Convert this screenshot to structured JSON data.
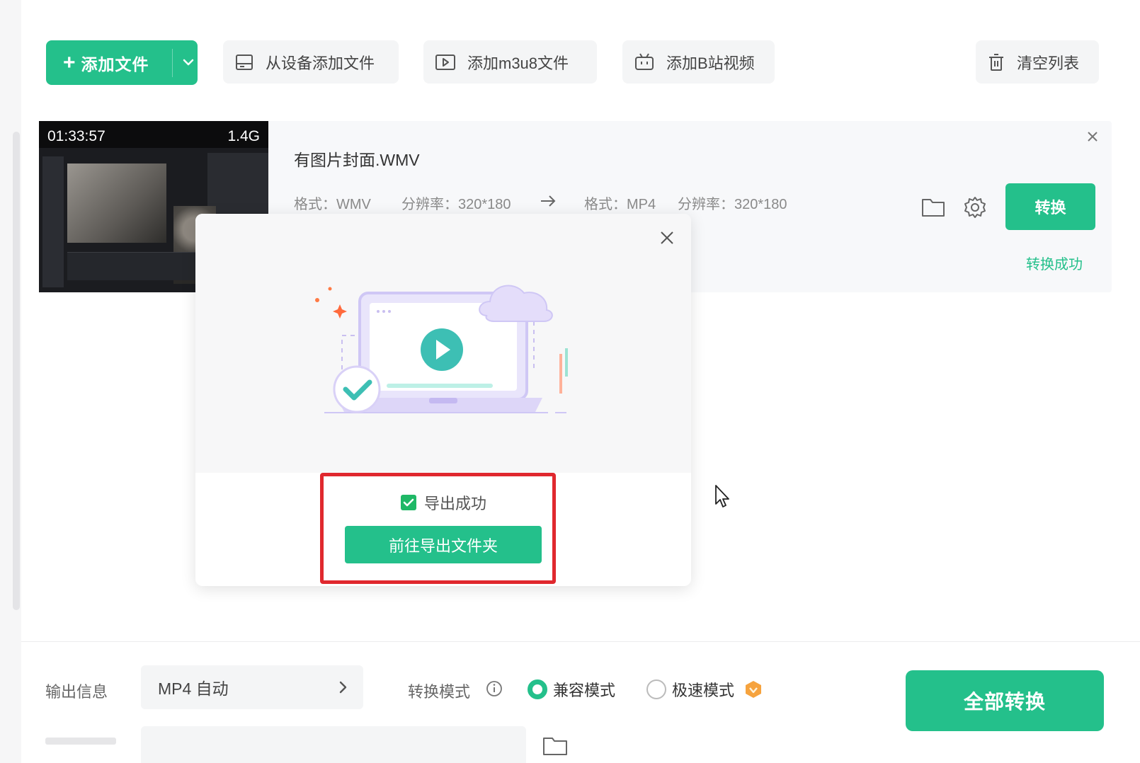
{
  "toolbar": {
    "add_file_label": "添加文件",
    "add_from_device_label": "从设备添加文件",
    "add_m3u8_label": "添加m3u8文件",
    "add_bilibili_label": "添加B站视频",
    "clear_list_label": "清空列表"
  },
  "file": {
    "duration": "01:33:57",
    "size": "1.4G",
    "name": "有图片封面.WMV",
    "input_format": "格式：WMV",
    "input_resolution": "分辨率：320*180",
    "output_format": "格式：MP4",
    "output_resolution": "分辨率：320*180",
    "convert_label": "转换",
    "status": "转换成功"
  },
  "modal": {
    "success_text": "导出成功",
    "goto_folder_label": "前往导出文件夹"
  },
  "bottom": {
    "output_info_label": "输出信息",
    "output_format_value": "MP4 自动",
    "mode_label": "转换模式",
    "mode_compat_label": "兼容模式",
    "mode_fast_label": "极速模式",
    "convert_all_label": "全部转换"
  },
  "colors": {
    "accent": "#24c08b",
    "highlight": "#e0282e"
  }
}
